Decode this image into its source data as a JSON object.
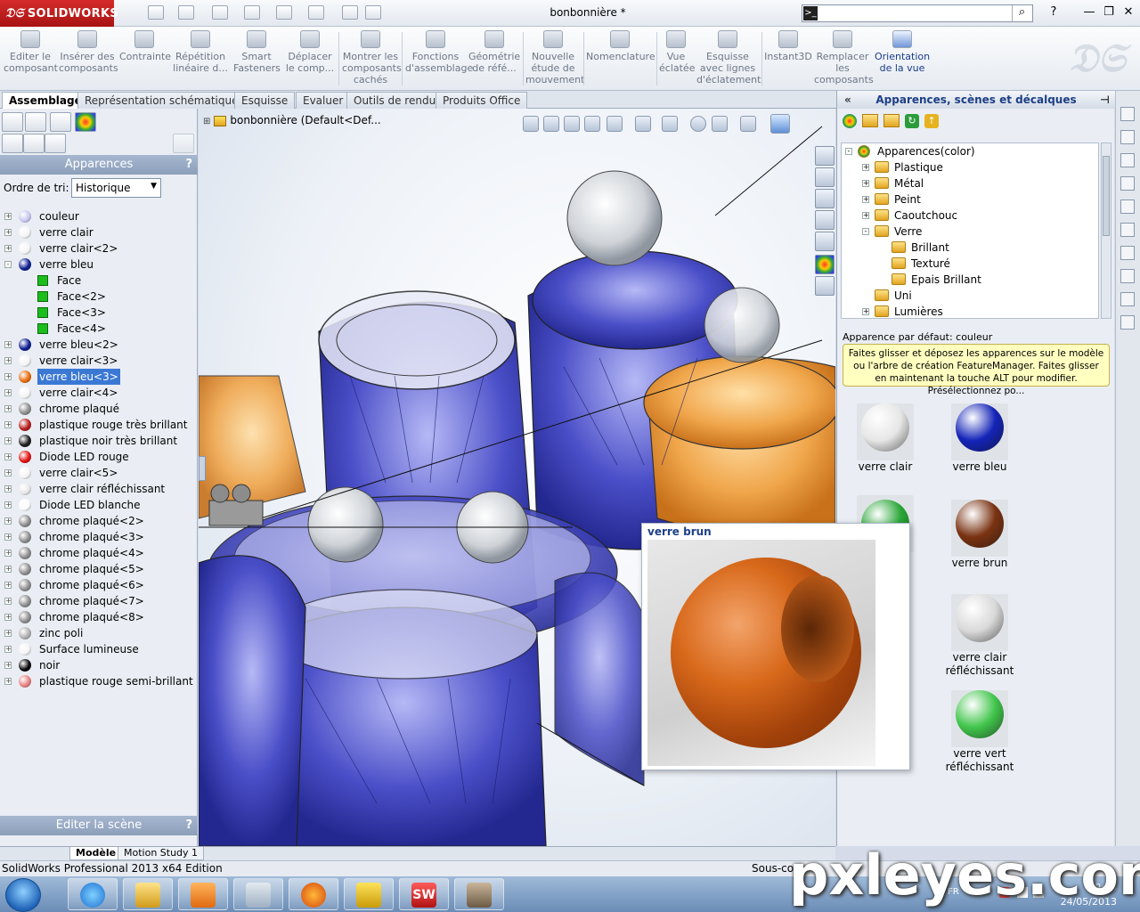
{
  "app": {
    "logo": "SOLIDWORKS",
    "document_title": "bonbonnière *",
    "search_placeholder": ""
  },
  "commands": [
    {
      "label": "Editer le composant"
    },
    {
      "label": "Insérer des composants"
    },
    {
      "label": "Contrainte"
    },
    {
      "label": "Répétition linéaire d..."
    },
    {
      "label": "Smart Fasteners"
    },
    {
      "label": "Déplacer le comp..."
    },
    {
      "label": "Montrer les composants cachés"
    },
    {
      "label": "Fonctions d'assemblage"
    },
    {
      "label": "Géométrie de réfé..."
    },
    {
      "label": "Nouvelle étude de mouvement"
    },
    {
      "label": "Nomenclature"
    },
    {
      "label": "Vue éclatée"
    },
    {
      "label": "Esquisse avec lignes d'éclatement"
    },
    {
      "label": "Instant3D"
    },
    {
      "label": "Remplacer les composants"
    },
    {
      "label": "Orientation de la vue"
    }
  ],
  "tabs": [
    "Assemblage",
    "Représentation schématique",
    "Esquisse",
    "Evaluer",
    "Outils de rendu",
    "Produits Office"
  ],
  "left_panel": {
    "header": "Apparences",
    "help": "?",
    "sort_label": "Ordre de tri:",
    "sort_value": "Historique",
    "scene_header": "Editer la scène",
    "items": [
      {
        "label": "couleur",
        "color": "#c8c8f0",
        "exp": "+"
      },
      {
        "label": "verre clair",
        "color": "#f4f4f4",
        "exp": "+"
      },
      {
        "label": "verre clair<2>",
        "color": "#f4f4f4",
        "exp": "+"
      },
      {
        "label": "verre bleu",
        "color": "#0b1c8f",
        "exp": "-"
      },
      {
        "label": "Face",
        "child": true
      },
      {
        "label": "Face<2>",
        "child": true
      },
      {
        "label": "Face<3>",
        "child": true
      },
      {
        "label": "Face<4>",
        "child": true
      },
      {
        "label": "verre bleu<2>",
        "color": "#0b1c8f",
        "exp": "+"
      },
      {
        "label": "verre clair<3>",
        "color": "#f4f4f4",
        "exp": "+"
      },
      {
        "label": "verre bleu<3>",
        "color": "#e86a0c",
        "exp": "+",
        "selected": true
      },
      {
        "label": "verre clair<4>",
        "color": "#f4f4f4",
        "exp": "+"
      },
      {
        "label": "chrome plaqué",
        "color": "#8c8c8c",
        "exp": "+"
      },
      {
        "label": "plastique rouge très brillant",
        "color": "#b51a1a",
        "exp": "+"
      },
      {
        "label": "plastique noir très brillant",
        "color": "#1a1a1a",
        "exp": "+"
      },
      {
        "label": "Diode LED rouge",
        "color": "#e21010",
        "exp": "+"
      },
      {
        "label": "verre clair<5>",
        "color": "#f4f4f4",
        "exp": "+"
      },
      {
        "label": "verre clair réfléchissant",
        "color": "#e8e8e8",
        "exp": "+"
      },
      {
        "label": "Diode LED blanche",
        "color": "#fafafa",
        "exp": "+"
      },
      {
        "label": "chrome plaqué<2>",
        "color": "#8c8c8c",
        "exp": "+"
      },
      {
        "label": "chrome plaqué<3>",
        "color": "#8c8c8c",
        "exp": "+"
      },
      {
        "label": "chrome plaqué<4>",
        "color": "#8c8c8c",
        "exp": "+"
      },
      {
        "label": "chrome plaqué<5>",
        "color": "#8c8c8c",
        "exp": "+"
      },
      {
        "label": "chrome plaqué<6>",
        "color": "#8c8c8c",
        "exp": "+"
      },
      {
        "label": "chrome plaqué<7>",
        "color": "#8c8c8c",
        "exp": "+"
      },
      {
        "label": "chrome plaqué<8>",
        "color": "#8c8c8c",
        "exp": "+"
      },
      {
        "label": "zinc poli",
        "color": "#b0b0b0",
        "exp": "+"
      },
      {
        "label": "Surface lumineuse",
        "color": "#f4f4f4",
        "exp": "+"
      },
      {
        "label": "noir",
        "color": "#050505",
        "exp": "+"
      },
      {
        "label": "plastique rouge semi-brillant",
        "color": "#e8807f",
        "exp": "+"
      }
    ]
  },
  "viewport": {
    "root_label": "bonbonnière  (Default<Def..."
  },
  "right_panel": {
    "header": "Apparences, scènes et décalques",
    "tree": [
      {
        "label": "Apparences(color)",
        "level": 0,
        "exp": "-"
      },
      {
        "label": "Plastique",
        "level": 1,
        "exp": "+"
      },
      {
        "label": "Métal",
        "level": 1,
        "exp": "+"
      },
      {
        "label": "Peint",
        "level": 1,
        "exp": "+"
      },
      {
        "label": "Caoutchouc",
        "level": 1,
        "exp": "+"
      },
      {
        "label": "Verre",
        "level": 1,
        "exp": "-"
      },
      {
        "label": "Brillant",
        "level": 2,
        "exp": ""
      },
      {
        "label": "Texturé",
        "level": 2,
        "exp": ""
      },
      {
        "label": "Epais Brillant",
        "level": 2,
        "exp": ""
      },
      {
        "label": "Uni",
        "level": 1,
        "exp": ""
      },
      {
        "label": "Lumières",
        "level": 1,
        "exp": "+"
      }
    ],
    "default_appearance": "Apparence par défaut: couleur",
    "hint": "Faites glisser et déposez les apparences sur le modèle ou l'arbre de création FeatureManager. Faites glisser en maintenant la touche ALT pour modifier. Présélectionnez po...",
    "swatches": [
      {
        "label": "verre clair",
        "color": "#e6e6e6"
      },
      {
        "label": "verre bleu",
        "color": "#1424b8"
      },
      {
        "label": "verre brun",
        "color": "#7a3312"
      },
      {
        "label": "verre clair réfléchissant",
        "color": "#d9d9d9"
      },
      {
        "label": "verre vert réfléchissant",
        "color": "#41c54b"
      }
    ]
  },
  "popup": {
    "title": "verre brun"
  },
  "model_tabs": [
    "Modèle",
    "Motion Study 1"
  ],
  "status": {
    "left": "SolidWorks Professional 2013 x64 Edition",
    "middle": "Sous-co"
  },
  "taskbar": {
    "lang": "FR",
    "time": "19:33",
    "date": "24/05/2013"
  },
  "watermark": "pxleyes.com"
}
